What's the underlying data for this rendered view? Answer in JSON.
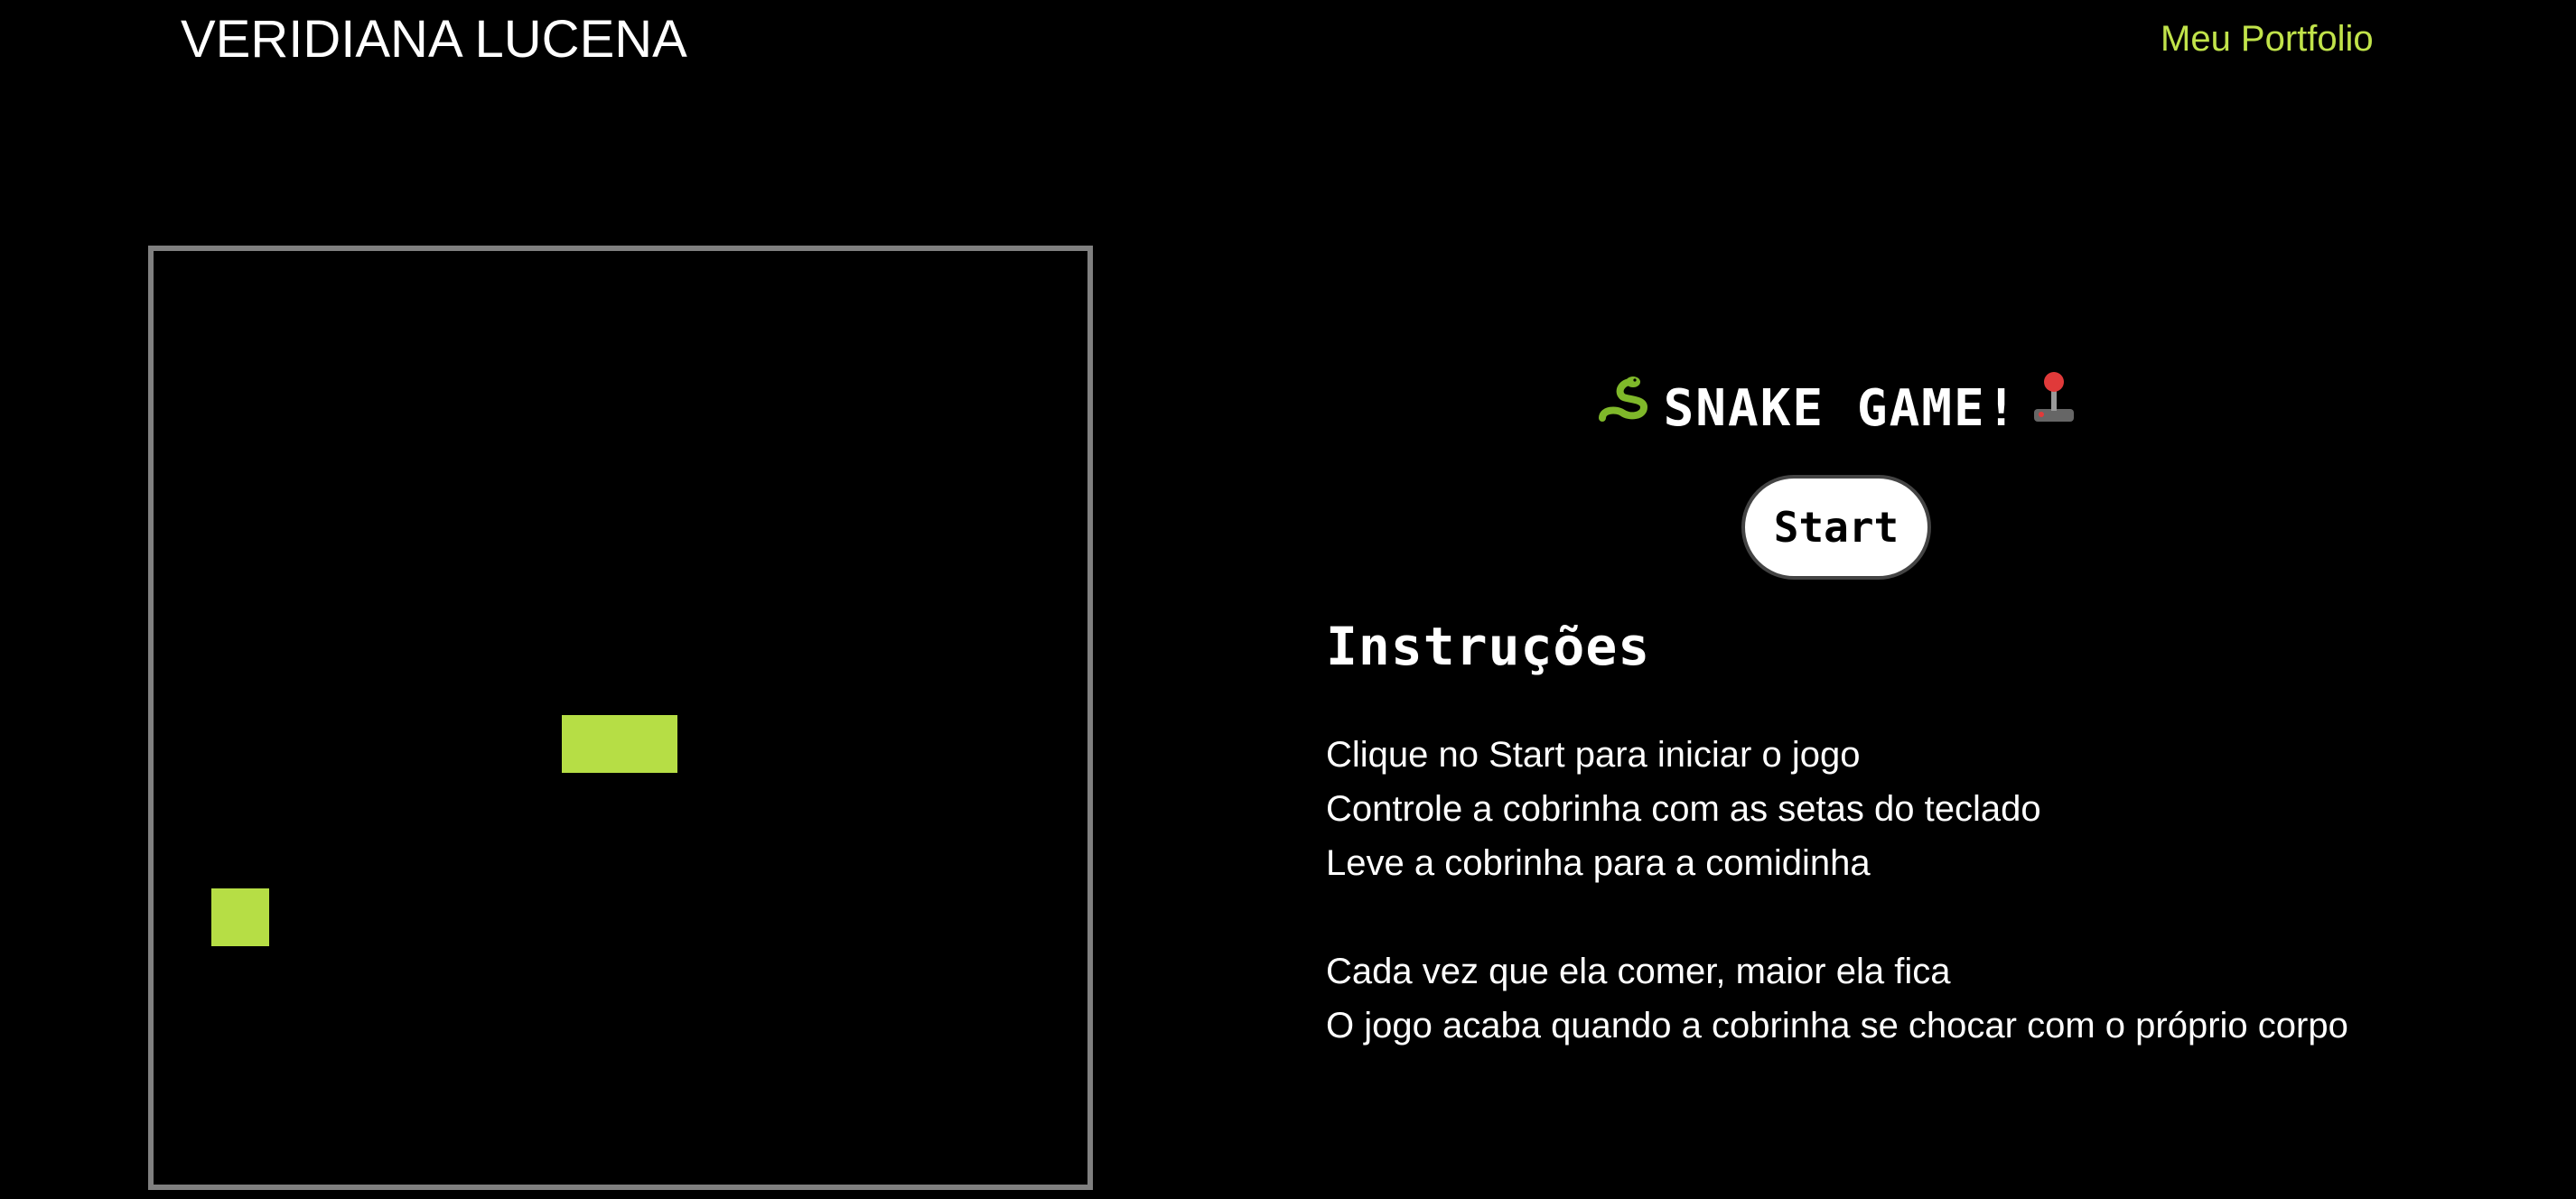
{
  "header": {
    "site_name": "VERIDIANA LUCENA",
    "portfolio_link": "Meu Portfolio"
  },
  "game": {
    "title": "SNAKE GAME!",
    "title_icons": [
      "snake-icon",
      "joystick-icon"
    ],
    "start_label": "Start",
    "snake_color": "#b6de45",
    "food_color": "#b6de45",
    "board_border_color": "#808080"
  },
  "instructions": {
    "heading": "Instruções",
    "lines": [
      "Clique no Start para iniciar o jogo",
      "Controle a cobrinha com as setas do teclado",
      "Leve a cobrinha para a comidinha",
      "Cada vez que ela comer, maior ela fica",
      "O jogo acaba quando a cobrinha se chocar com o próprio corpo"
    ]
  },
  "colors": {
    "background": "#000000",
    "accent": "#c1e34a",
    "text": "#ffffff"
  }
}
